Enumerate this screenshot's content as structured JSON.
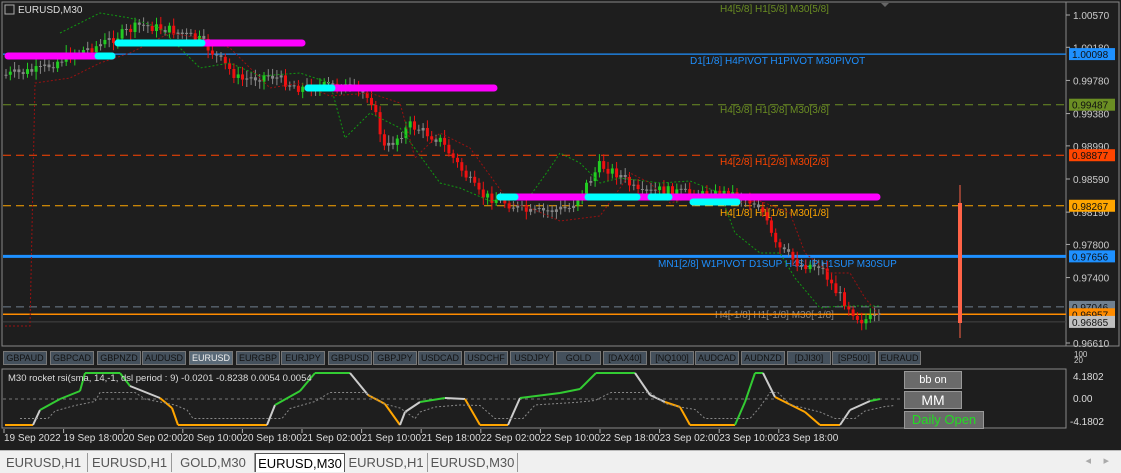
{
  "chart": {
    "title": "EURUSD,M30",
    "price_axis": [
      "1.00570",
      "1.00180",
      "0.99780",
      "0.99380",
      "0.98990",
      "0.98590",
      "0.98190",
      "0.97800",
      "0.97400",
      "0.96610"
    ],
    "levels": [
      {
        "label": "H4[5/8] H1[5/8] M30[5/8]",
        "price": null,
        "color": "#6b8e23"
      },
      {
        "label": "D1[1/8] H4PIVOT H1PIVOT M30PIVOT",
        "price": "1.00098",
        "color": "#1e90ff"
      },
      {
        "label": "H4[3/8] H1[3/8] M30[3/8]",
        "price": "0.99487",
        "color": "#6b8e23"
      },
      {
        "label": "H4[2/8] H1[2/8] M30[2/8]",
        "price": "0.98877",
        "color": "#ff4500"
      },
      {
        "label": "H4[1/8] H1[1/8] M30[1/8]",
        "price": "0.98267",
        "color": "#ffa500"
      },
      {
        "label": "MN1[2/8] W1PIVOT D1SUP H4SUP H1SUP M30SUP",
        "price": "0.97656",
        "color": "#1e90ff"
      },
      {
        "label": "H4[-1/8] H1[-1/8] M30[-1/8]",
        "price": "0.97046",
        "color": "#708090"
      },
      {
        "label": "",
        "price": "0.96957",
        "color": "#ff8c00"
      },
      {
        "label": "",
        "price": "0.96865",
        "color": "#c0c0c0"
      }
    ]
  },
  "symbols": [
    "GBPAUD",
    "GBPCAD",
    "GBPNZD",
    "AUDUSD",
    "EURUSD",
    "EURGBP",
    "EURJPY",
    "GBPUSD",
    "GBPJPY",
    "USDCAD",
    "USDCHF",
    "USDJPY",
    "GOLD",
    "[DAX40]",
    "[NQ100]",
    "AUDCAD",
    "AUDNZD",
    "[DJI30]",
    "[SP500]",
    "EURAUD"
  ],
  "active_symbol": "EURUSD",
  "indicator": {
    "label": "M30 rocket rsi(sma, 14,-1, dsl period : 9) -0.0201 -0.8238 0.0054 0.0054",
    "axis": [
      "4.1802",
      "0.00",
      "-4.1802"
    ],
    "small_axis": [
      "100",
      "20"
    ]
  },
  "buttons": {
    "bb": "bb on",
    "mm": "MM",
    "daily": "Daily Open"
  },
  "time_axis": [
    "19 Sep 2022",
    "19 Sep 18:00",
    "20 Sep 02:00",
    "20 Sep 10:00",
    "20 Sep 18:00",
    "21 Sep 02:00",
    "21 Sep 10:00",
    "21 Sep 18:00",
    "22 Sep 02:00",
    "22 Sep 10:00",
    "22 Sep 18:00",
    "23 Sep 02:00",
    "23 Sep 10:00",
    "23 Sep 18:00"
  ],
  "tabs": [
    "EURUSD,H1",
    "EURUSD,H1",
    "GOLD,M30",
    "EURUSD,M30",
    "EURUSD,H1",
    "EURUSD,M30"
  ],
  "active_tab": 3
}
